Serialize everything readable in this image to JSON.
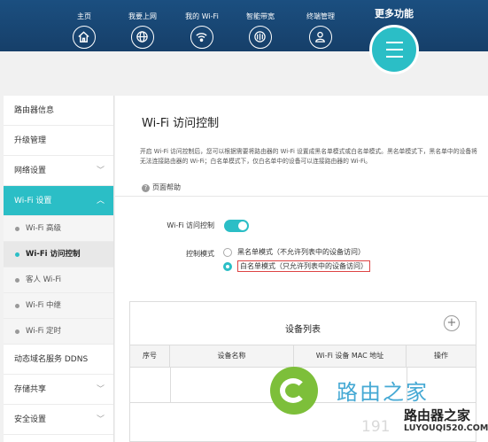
{
  "header": {
    "nav": [
      {
        "label": "主页",
        "icon": "home-icon"
      },
      {
        "label": "我要上网",
        "icon": "globe-icon"
      },
      {
        "label": "我的 Wi-Fi",
        "icon": "wifi-icon"
      },
      {
        "label": "智能带宽",
        "icon": "bandwidth-icon"
      },
      {
        "label": "终端管理",
        "icon": "user-icon"
      }
    ],
    "more": {
      "label": "更多功能",
      "icon": "menu-icon"
    }
  },
  "sidebar": {
    "items": [
      {
        "label": "路由器信息"
      },
      {
        "label": "升级管理"
      },
      {
        "label": "网络设置",
        "chevron": "﹀"
      },
      {
        "label": "Wi-Fi 设置",
        "chevron": "︿"
      },
      {
        "label": "动态域名服务 DDNS"
      },
      {
        "label": "存储共享",
        "chevron": "﹀"
      },
      {
        "label": "安全设置",
        "chevron": "﹀"
      }
    ],
    "sub_items": [
      {
        "label": "Wi-Fi 高级"
      },
      {
        "label": "Wi-Fi 访问控制"
      },
      {
        "label": "客人 Wi-Fi"
      },
      {
        "label": "Wi-Fi 中继"
      },
      {
        "label": "Wi-Fi 定时"
      }
    ]
  },
  "main": {
    "title": "Wi-Fi 访问控制",
    "description": "开启 Wi-Fi 访问控制后，您可以根据需要将路由器的 Wi-Fi 设置成黑名单模式或白名单模式。黑名单模式下，黑名单中的设备将无法连接路由器的 Wi-Fi；白名单模式下，仅白名单中的设备可以连接路由器的 Wi-Fi。",
    "help_label": "页面帮助",
    "form": {
      "access_control_label": "Wi-Fi 访问控制",
      "access_control_enabled": true,
      "mode_label": "控制模式",
      "mode_options": [
        {
          "label": "黑名单模式（不允许列表中的设备访问）",
          "checked": false
        },
        {
          "label": "白名单模式（只允许列表中的设备访问）",
          "checked": true
        }
      ]
    },
    "device_table": {
      "title": "设备列表",
      "add_symbol": "+",
      "columns": [
        "序号",
        "设备名称",
        "Wi-Fi 设备 MAC 地址",
        "操作"
      ],
      "rows": []
    }
  },
  "watermark": {
    "logo_text": "路由之家",
    "partial_number": "191",
    "brand": "路由器之家",
    "url": "LUYOUQI520.COM"
  },
  "colors": {
    "header_bg": "#1b4f80",
    "accent": "#2bbec6"
  }
}
